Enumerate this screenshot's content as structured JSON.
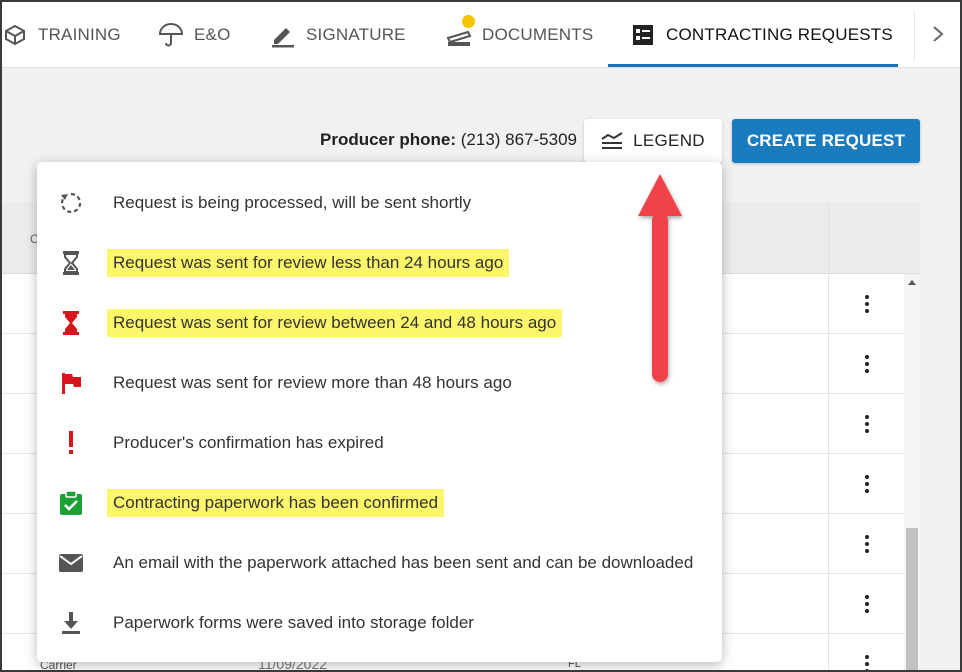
{
  "tabs": [
    {
      "label": "TRAINING",
      "icon": "box-icon"
    },
    {
      "label": "E&O",
      "icon": "umbrella-icon"
    },
    {
      "label": "SIGNATURE",
      "icon": "pen-icon"
    },
    {
      "label": "DOCUMENTS",
      "icon": "documents-icon"
    },
    {
      "label": "CONTRACTING REQUESTS",
      "icon": "list-icon"
    }
  ],
  "toolbar": {
    "phone_label": "Producer phone:",
    "phone_value": "(213) 867-5309",
    "legend_label": "LEGEND",
    "create_label": "CREATE REQUEST"
  },
  "legend": [
    {
      "text": "Request is being processed, will be sent shortly",
      "icon": "processing-icon",
      "highlight": false
    },
    {
      "text": "Request was sent for review less than 24 hours ago",
      "icon": "hourglass-gray-icon",
      "highlight": true
    },
    {
      "text": "Request was sent for review between 24 and 48 hours ago",
      "icon": "hourglass-red-icon",
      "highlight": true
    },
    {
      "text": "Request was sent for review more than 48 hours ago",
      "icon": "flag-icon",
      "highlight": false
    },
    {
      "text": "Producer's confirmation has expired",
      "icon": "exclamation-icon",
      "highlight": false
    },
    {
      "text": "Contracting paperwork has been confirmed",
      "icon": "clipboard-check-icon",
      "highlight": true
    },
    {
      "text": "An email with the paperwork attached has been sent and can be downloaded",
      "icon": "envelope-icon",
      "highlight": false
    },
    {
      "text": "Paperwork forms were saved into storage folder",
      "icon": "download-icon",
      "highlight": false
    }
  ],
  "table": {
    "header_stub": "C",
    "footer_cells": [
      "Carrier",
      "11/09/2022",
      "FL"
    ]
  },
  "colors": {
    "accent": "#1a7bbf",
    "highlight": "#fbf66a",
    "red": "#d8141c",
    "green": "#1aa135",
    "arrow": "#f0434a",
    "badge": "#f5c400"
  }
}
